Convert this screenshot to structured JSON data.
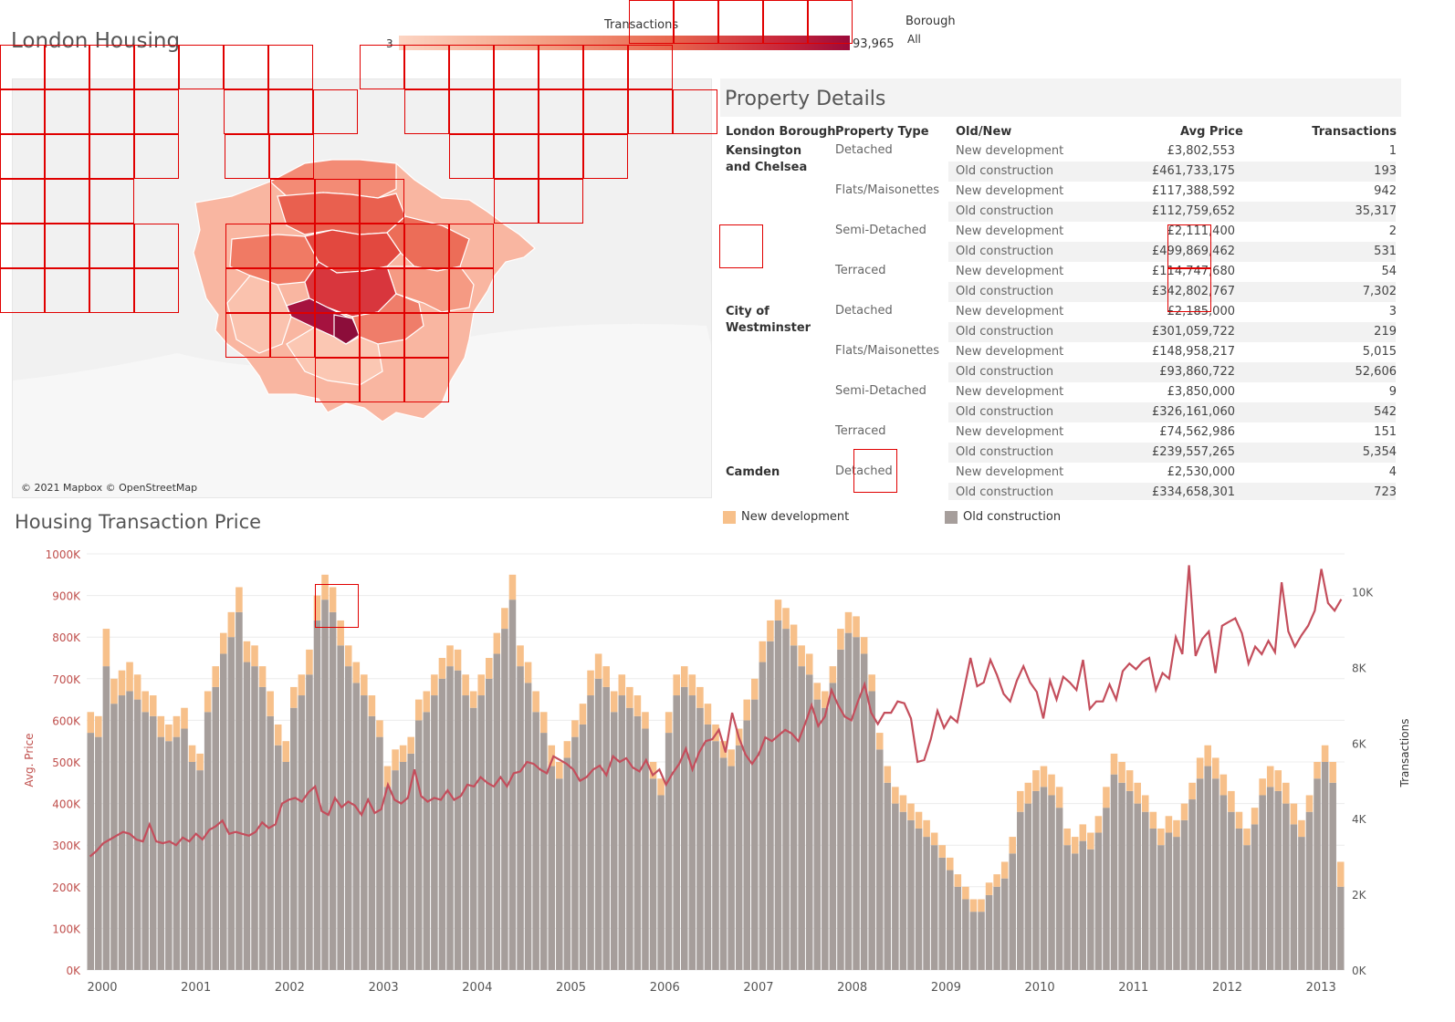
{
  "dashboard": {
    "title": "London Housing",
    "legend": {
      "title": "Transactions",
      "min_label": "3",
      "max_label": "93,965"
    },
    "filter": {
      "label": "Borough",
      "value": "All"
    }
  },
  "map": {
    "credit": "© 2021 Mapbox © OpenStreetMap",
    "colors": {
      "low": "#fcd4c2",
      "mid": "#eb7a63",
      "high": "#a5123f"
    }
  },
  "property_details": {
    "title": "Property Details",
    "headers": [
      "London Borough",
      "Property Type",
      "Old/New",
      "Avg Price",
      "Transactions"
    ],
    "boroughs": [
      {
        "name": "Kensington and Chelsea",
        "types": [
          {
            "type": "Detached",
            "rows": [
              [
                "New development",
                "£3,802,553",
                "1"
              ],
              [
                "Old construction",
                "£461,733,175",
                "193"
              ]
            ]
          },
          {
            "type": "Flats/Maisonettes",
            "rows": [
              [
                "New development",
                "£117,388,592",
                "942"
              ],
              [
                "Old construction",
                "£112,759,652",
                "35,317"
              ]
            ]
          },
          {
            "type": "Semi-Detached",
            "rows": [
              [
                "New development",
                "£2,111,400",
                "2"
              ],
              [
                "Old construction",
                "£499,869,462",
                "531"
              ]
            ]
          },
          {
            "type": "Terraced",
            "rows": [
              [
                "New development",
                "£114,747,680",
                "54"
              ],
              [
                "Old construction",
                "£342,802,767",
                "7,302"
              ]
            ]
          }
        ]
      },
      {
        "name": "City of Westminster",
        "types": [
          {
            "type": "Detached",
            "rows": [
              [
                "New development",
                "£2,185,000",
                "3"
              ],
              [
                "Old construction",
                "£301,059,722",
                "219"
              ]
            ]
          },
          {
            "type": "Flats/Maisonettes",
            "rows": [
              [
                "New development",
                "£148,958,217",
                "5,015"
              ],
              [
                "Old construction",
                "£93,860,722",
                "52,606"
              ]
            ]
          },
          {
            "type": "Semi-Detached",
            "rows": [
              [
                "New development",
                "£3,850,000",
                "9"
              ],
              [
                "Old construction",
                "£326,161,060",
                "542"
              ]
            ]
          },
          {
            "type": "Terraced",
            "rows": [
              [
                "New development",
                "£74,562,986",
                "151"
              ],
              [
                "Old construction",
                "£239,557,265",
                "5,354"
              ]
            ]
          }
        ]
      },
      {
        "name": "Camden",
        "types": [
          {
            "type": "Detached",
            "rows": [
              [
                "New development",
                "£2,530,000",
                "4"
              ],
              [
                "Old construction",
                "£334,658,301",
                "723"
              ]
            ]
          }
        ]
      }
    ]
  },
  "chart_data": {
    "type": "bar",
    "title": "Housing Transaction Price",
    "ylabel": "Avg. Price",
    "y2label": "Transactions",
    "ylim": [
      0,
      1000000
    ],
    "y2lim": [
      0,
      11000
    ],
    "y_ticks": [
      "0K",
      "100K",
      "200K",
      "300K",
      "400K",
      "500K",
      "600K",
      "700K",
      "800K",
      "900K",
      "1000K"
    ],
    "y2_ticks": [
      "0K",
      "2K",
      "4K",
      "6K",
      "8K",
      "10K"
    ],
    "x_ticks": [
      "2000",
      "2001",
      "2002",
      "2003",
      "2004",
      "2005",
      "2006",
      "2007",
      "2008",
      "2009",
      "2010",
      "2011",
      "2012",
      "2013"
    ],
    "start": "2000-01",
    "legend": [
      "New development",
      "Old construction"
    ],
    "colors": {
      "new": "#f7c08a",
      "old": "#a69e9b",
      "line": "#c44e5c",
      "axis_left": "#c0504d"
    },
    "series": [
      {
        "name": "Old construction",
        "values": [
          5.7,
          5.6,
          7.3,
          6.4,
          6.6,
          6.7,
          6.5,
          6.2,
          6.1,
          5.6,
          5.5,
          5.6,
          5.8,
          5.0,
          4.8,
          6.2,
          6.8,
          7.6,
          8.0,
          8.6,
          7.4,
          7.3,
          6.8,
          6.1,
          5.4,
          5.0,
          6.3,
          6.6,
          7.1,
          8.4,
          8.9,
          8.6,
          7.8,
          7.3,
          6.9,
          6.6,
          6.1,
          5.6,
          4.4,
          4.8,
          5.0,
          5.2,
          6.0,
          6.2,
          6.6,
          7.0,
          7.3,
          7.2,
          6.6,
          6.3,
          6.6,
          7.0,
          7.6,
          8.2,
          8.9,
          7.3,
          6.9,
          6.2,
          5.7,
          4.9,
          4.6,
          5.1,
          5.6,
          5.9,
          6.6,
          7.0,
          6.8,
          6.2,
          6.6,
          6.3,
          6.1,
          5.8,
          4.6,
          4.2,
          5.7,
          6.6,
          6.8,
          6.6,
          6.3,
          5.9,
          5.5,
          5.1,
          4.9,
          5.4,
          6.0,
          6.5,
          7.4,
          7.9,
          8.4,
          8.2,
          7.8,
          7.3,
          7.1,
          6.5,
          6.3,
          6.9,
          7.7,
          8.1,
          8.0,
          7.6,
          6.7,
          5.3,
          4.5,
          4.0,
          3.8,
          3.6,
          3.4,
          3.2,
          3.0,
          2.7,
          2.4,
          2.0,
          1.7,
          1.4,
          1.4,
          1.8,
          2.0,
          2.2,
          2.8,
          3.8,
          4.0,
          4.3,
          4.4,
          4.2,
          3.9,
          3.0,
          2.8,
          3.1,
          2.9,
          3.3,
          3.9,
          4.7,
          4.5,
          4.3,
          4.0,
          3.8,
          3.4,
          3.0,
          3.3,
          3.2,
          3.6,
          4.1,
          4.6,
          4.9,
          4.6,
          4.2,
          3.8,
          3.4,
          3.0,
          3.5,
          4.2,
          4.4,
          4.3,
          4.0,
          3.5,
          3.2,
          3.8,
          4.6,
          5.0,
          4.5,
          2.0
        ]
      },
      {
        "name": "New development",
        "values": [
          0.5,
          0.5,
          0.9,
          0.6,
          0.6,
          0.7,
          0.6,
          0.5,
          0.5,
          0.5,
          0.4,
          0.5,
          0.5,
          0.4,
          0.4,
          0.5,
          0.5,
          0.5,
          0.6,
          0.6,
          0.5,
          0.5,
          0.5,
          0.6,
          0.5,
          0.5,
          0.5,
          0.5,
          0.6,
          0.6,
          0.6,
          0.6,
          0.6,
          0.5,
          0.5,
          0.5,
          0.5,
          0.4,
          0.5,
          0.5,
          0.4,
          0.4,
          0.5,
          0.5,
          0.5,
          0.5,
          0.5,
          0.5,
          0.5,
          0.4,
          0.5,
          0.5,
          0.5,
          0.5,
          0.6,
          0.5,
          0.5,
          0.5,
          0.5,
          0.5,
          0.4,
          0.4,
          0.4,
          0.5,
          0.6,
          0.6,
          0.5,
          0.5,
          0.5,
          0.5,
          0.5,
          0.4,
          0.4,
          0.4,
          0.5,
          0.5,
          0.5,
          0.5,
          0.5,
          0.5,
          0.4,
          0.4,
          0.4,
          0.4,
          0.5,
          0.5,
          0.5,
          0.5,
          0.5,
          0.5,
          0.5,
          0.5,
          0.5,
          0.4,
          0.4,
          0.4,
          0.5,
          0.5,
          0.5,
          0.4,
          0.4,
          0.4,
          0.4,
          0.4,
          0.4,
          0.4,
          0.4,
          0.4,
          0.3,
          0.3,
          0.3,
          0.3,
          0.3,
          0.3,
          0.3,
          0.3,
          0.3,
          0.4,
          0.4,
          0.5,
          0.5,
          0.5,
          0.5,
          0.5,
          0.5,
          0.4,
          0.4,
          0.4,
          0.4,
          0.4,
          0.5,
          0.5,
          0.5,
          0.5,
          0.5,
          0.4,
          0.4,
          0.4,
          0.4,
          0.4,
          0.4,
          0.4,
          0.5,
          0.5,
          0.5,
          0.5,
          0.5,
          0.4,
          0.4,
          0.4,
          0.4,
          0.5,
          0.5,
          0.5,
          0.5,
          0.4,
          0.4,
          0.4,
          0.4,
          0.5,
          0.6,
          0.5,
          0.3
        ]
      },
      {
        "name": "Transactions",
        "axis": "right",
        "values": [
          3000,
          3150,
          3350,
          3450,
          3550,
          3650,
          3600,
          3450,
          3400,
          3850,
          3400,
          3350,
          3400,
          3300,
          3500,
          3400,
          3600,
          3450,
          3700,
          3800,
          3950,
          3600,
          3650,
          3600,
          3550,
          3650,
          3900,
          3750,
          3850,
          4400,
          4500,
          4550,
          4450,
          4700,
          4850,
          4200,
          4100,
          4550,
          4300,
          4450,
          4350,
          4100,
          4500,
          4150,
          4250,
          4900,
          4500,
          4400,
          4550,
          5300,
          4600,
          4450,
          4550,
          4500,
          4750,
          4500,
          4600,
          4900,
          4850,
          5100,
          4950,
          4850,
          5100,
          4850,
          5200,
          5250,
          5500,
          5450,
          5300,
          5200,
          5650,
          5550,
          5450,
          5300,
          5000,
          5100,
          5300,
          5400,
          5150,
          5650,
          5500,
          5600,
          5350,
          5250,
          5550,
          5150,
          5300,
          4900,
          5200,
          5450,
          5850,
          5300,
          5750,
          6050,
          6100,
          6350,
          5750,
          6800,
          6150,
          5700,
          5450,
          5700,
          6150,
          6050,
          6200,
          6350,
          6250,
          6050,
          6500,
          7000,
          6450,
          6700,
          7400,
          7000,
          6700,
          6600,
          7100,
          7550,
          6800,
          6500,
          6800,
          6800,
          7100,
          7050,
          6650,
          5500,
          5550,
          6100,
          6850,
          6400,
          6700,
          6550,
          7400,
          8250,
          7500,
          7600,
          8200,
          7800,
          7300,
          7100,
          7650,
          8030,
          7600,
          7350,
          6650,
          7650,
          7150,
          7750,
          7600,
          7400,
          8200,
          6900,
          7100,
          7100,
          7550,
          7150,
          7900,
          8100,
          7950,
          8150,
          8250,
          7400,
          7850,
          7700,
          8800,
          8350,
          10700,
          8300,
          8750,
          8950,
          7850,
          9100,
          9200,
          9300,
          8900,
          8100,
          8550,
          8350,
          8700,
          8400,
          10250,
          8950,
          8550,
          8850,
          9100,
          9500,
          10600,
          9700,
          9500,
          9800
        ]
      }
    ]
  }
}
